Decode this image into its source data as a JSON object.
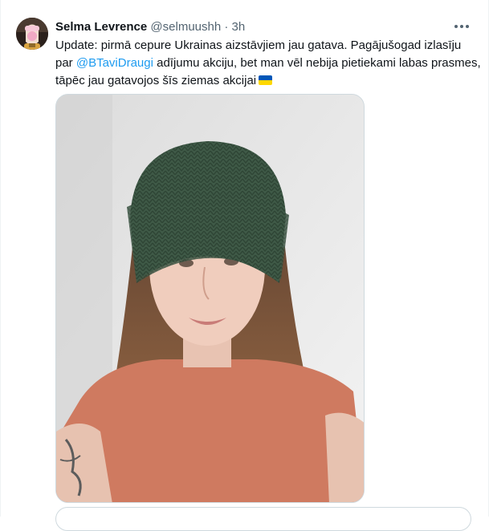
{
  "tweet": {
    "author_name": "Selma Levrence",
    "author_handle": "@selmuushh",
    "separator": "·",
    "time": "3h",
    "text_part1": "Update: pirmā cepure Ukrainas aizstāvjiem jau gatava. Pagājušogad izlasīju par ",
    "mention": "@BTaviDraugi",
    "text_part2": " adījumu akciju, bet man vēl nebija pietiekami labas prasmes, tāpēc jau gatavojos šīs ziemas akcijai",
    "flag_icon": "ukraine-flag-emoji",
    "more_icon": "more-options-icon"
  },
  "colors": {
    "text": "#0f1419",
    "secondary": "#536471",
    "link": "#1d9bf0",
    "border": "#cfd9de",
    "flag_blue": "#0057b7",
    "flag_yellow": "#ffd700"
  }
}
